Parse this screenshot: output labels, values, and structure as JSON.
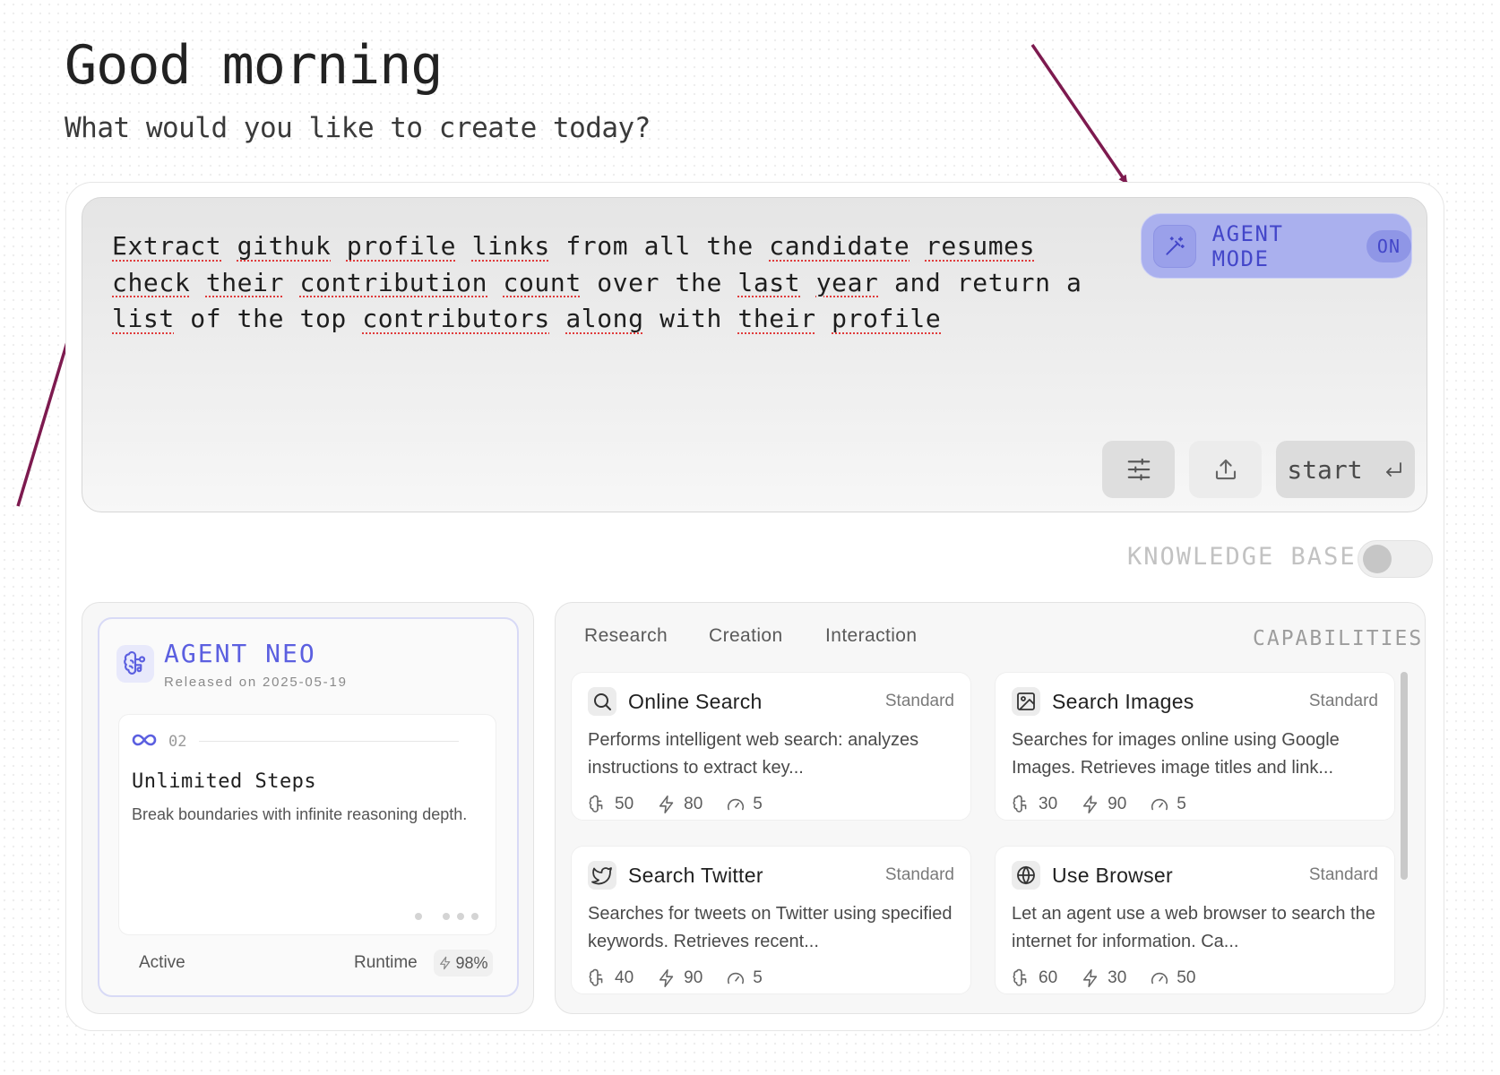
{
  "header": {
    "greeting": "Good morning",
    "subtitle": "What would you like to create today?"
  },
  "prompt": {
    "segments": [
      {
        "text": "Extract",
        "squiggle": true
      },
      {
        "text": " "
      },
      {
        "text": "githuk",
        "squiggle": true
      },
      {
        "text": " "
      },
      {
        "text": "profile",
        "squiggle": true
      },
      {
        "text": " "
      },
      {
        "text": "links",
        "squiggle": true
      },
      {
        "text": " from all the "
      },
      {
        "text": "candidate",
        "squiggle": true
      },
      {
        "text": " "
      },
      {
        "text": "resumes",
        "squiggle": true
      },
      {
        "text": " "
      },
      {
        "text": "check",
        "squiggle": true
      },
      {
        "text": " "
      },
      {
        "text": "their",
        "squiggle": true
      },
      {
        "text": " "
      },
      {
        "text": "contribution",
        "squiggle": true
      },
      {
        "text": " "
      },
      {
        "text": "count",
        "squiggle": true
      },
      {
        "text": " over the "
      },
      {
        "text": "last",
        "squiggle": true
      },
      {
        "text": " "
      },
      {
        "text": "year",
        "squiggle": true
      },
      {
        "text": " and return a "
      },
      {
        "text": "list",
        "squiggle": true
      },
      {
        "text": " of the top "
      },
      {
        "text": "contributors",
        "squiggle": true
      },
      {
        "text": " "
      },
      {
        "text": "along",
        "squiggle": true
      },
      {
        "text": " with "
      },
      {
        "text": "their",
        "squiggle": true
      },
      {
        "text": " "
      },
      {
        "text": "profile",
        "squiggle": true
      }
    ]
  },
  "agent_mode": {
    "label": "AGENT MODE",
    "state": "ON",
    "icon": "magic-wand-icon"
  },
  "actions": {
    "filter_icon": "sliders-icon",
    "upload_icon": "upload-icon",
    "start_label": "start",
    "start_icon": "enter-icon"
  },
  "knowledge_base": {
    "label": "KNOWLEDGE BASE",
    "enabled": false
  },
  "agent": {
    "name": "AGENT NEO",
    "release": "Released on 2025-05-19",
    "step_number": "02",
    "step_title": "Unlimited Steps",
    "step_desc": "Break boundaries with infinite reasoning depth.",
    "status": "Active",
    "runtime_label": "Runtime",
    "runtime_value": "98%"
  },
  "capabilities": {
    "tabs": [
      "Research",
      "Creation",
      "Interaction"
    ],
    "label": "CAPABILITIES",
    "cards": [
      {
        "icon": "search-icon",
        "title": "Online Search",
        "tier": "Standard",
        "desc": "Performs intelligent web search: analyzes instructions to extract key...",
        "brain": "50",
        "bolt": "80",
        "gauge": "5"
      },
      {
        "icon": "image-icon",
        "title": "Search Images",
        "tier": "Standard",
        "desc": "Searches for images online using Google Images. Retrieves image titles and link...",
        "brain": "30",
        "bolt": "90",
        "gauge": "5"
      },
      {
        "icon": "twitter-icon",
        "title": "Search Twitter",
        "tier": "Standard",
        "desc": "Searches for tweets on Twitter using specified keywords. Retrieves recent...",
        "brain": "40",
        "bolt": "90",
        "gauge": "5"
      },
      {
        "icon": "globe-icon",
        "title": "Use Browser",
        "tier": "Standard",
        "desc": "Let an agent use a web browser to search the internet for information. Ca...",
        "brain": "60",
        "bolt": "30",
        "gauge": "50"
      }
    ]
  },
  "colors": {
    "accent": "#5b5fe0",
    "annotation_arrow": "#7d1a4f"
  }
}
